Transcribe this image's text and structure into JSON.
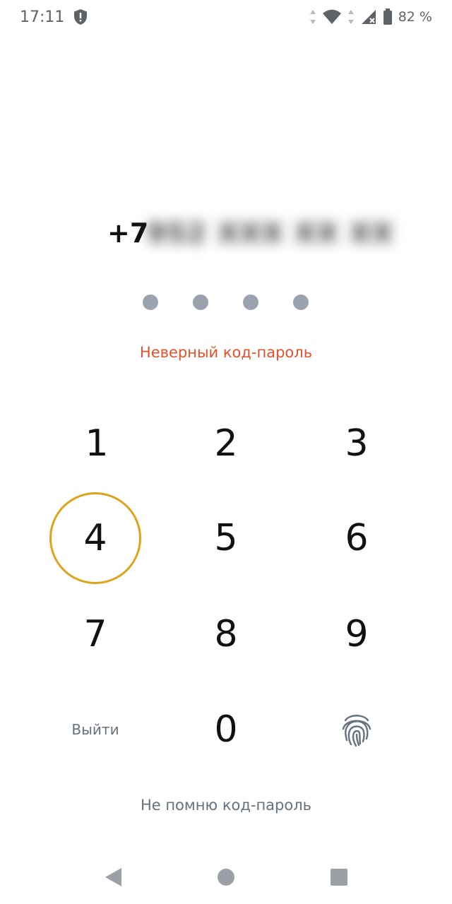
{
  "status_bar": {
    "time": "17:11",
    "battery_percent": "82 %",
    "icons": [
      "shield-alert-icon",
      "wifi-icon",
      "signal-icon",
      "battery-icon"
    ]
  },
  "login": {
    "phone_prefix": "+7",
    "phone_masked": "952 XXX XX XX",
    "pin_length": 4,
    "pin_entered": 0,
    "error_message": "Неверный код-пароль"
  },
  "keypad": {
    "keys": [
      "1",
      "2",
      "3",
      "4",
      "5",
      "6",
      "7",
      "8",
      "9",
      "0"
    ],
    "pressed_key": "4",
    "logout_label": "Выйти",
    "biometric_icon": "fingerprint-icon"
  },
  "forgot_label": "Не помню код-пароль",
  "nav_bar": {
    "buttons": [
      "back-icon",
      "home-icon",
      "recents-icon"
    ]
  },
  "colors": {
    "error": "#e8502b",
    "accent": "#e0a21b",
    "muted": "#66717d",
    "dot": "#9aa3ad"
  }
}
